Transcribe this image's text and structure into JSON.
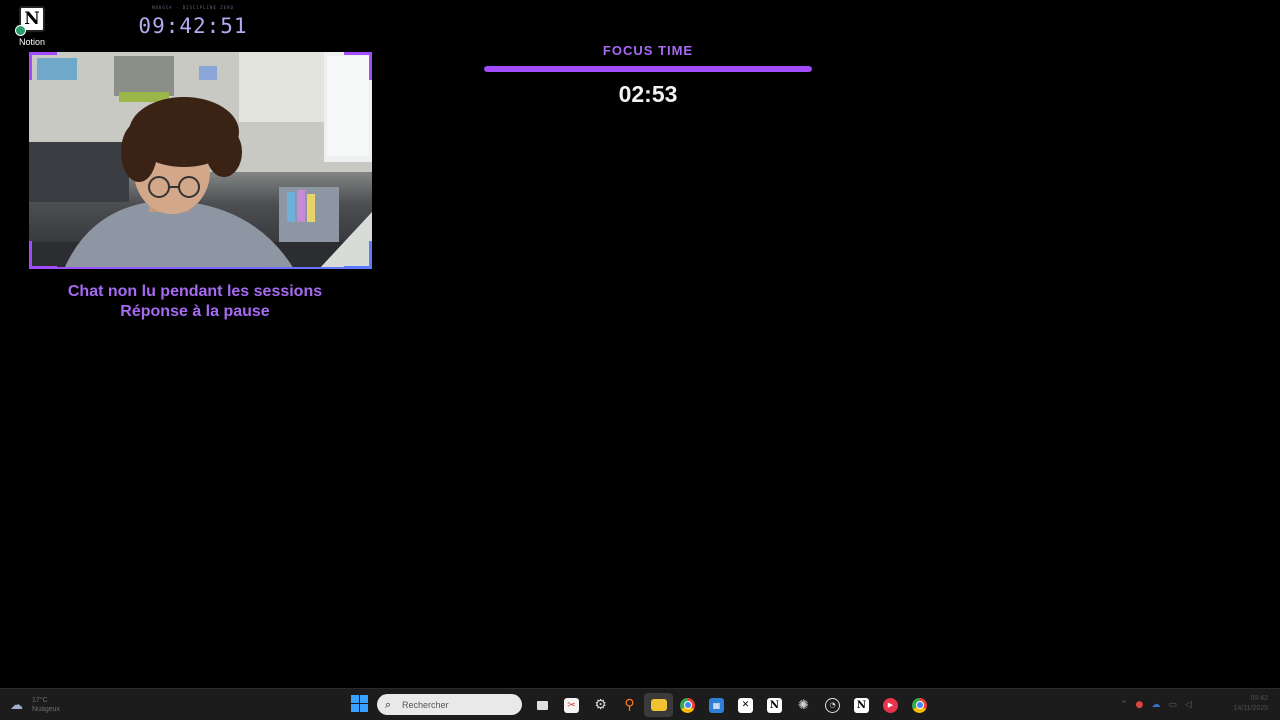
{
  "desktop": {
    "icons": [
      {
        "label": "Notion",
        "icon": "notion-icon"
      }
    ]
  },
  "clock_widget": {
    "caption": "NOUGIA · DISCIPLINE ZERO",
    "time": "09:42:51"
  },
  "webcam": {
    "accent_color": "#a24cff"
  },
  "chat_notice": {
    "line1": "Chat non lu pendant les sessions",
    "line2": "Réponse à la pause"
  },
  "focus": {
    "label": "FOCUS TIME",
    "time_remaining": "02:53",
    "progress_fraction": 1.0,
    "accent_color": "#a24cff"
  },
  "taskbar": {
    "weather": {
      "temp": "17°C",
      "condition": "Nuageux",
      "icon": "weather-cloud-icon"
    },
    "search_placeholder": "Rechercher",
    "apps": [
      {
        "name": "task-view",
        "icon": "task-view-icon"
      },
      {
        "name": "snipping-tool",
        "icon": "snipping-tool-icon"
      },
      {
        "name": "settings",
        "icon": "settings-icon"
      },
      {
        "name": "search-app",
        "icon": "magnifier-app-icon"
      },
      {
        "name": "file-explorer",
        "icon": "folder-icon"
      },
      {
        "name": "chrome",
        "icon": "chrome-icon"
      },
      {
        "name": "microsoft-store",
        "icon": "store-icon"
      },
      {
        "name": "capcut",
        "icon": "capcut-icon"
      },
      {
        "name": "notion",
        "icon": "notion-icon"
      },
      {
        "name": "chatgpt",
        "icon": "openai-icon"
      },
      {
        "name": "obs",
        "icon": "obs-icon"
      },
      {
        "name": "notion-2",
        "icon": "notion-icon"
      },
      {
        "name": "media-player",
        "icon": "play-icon"
      },
      {
        "name": "chrome-profile",
        "icon": "chrome-icon"
      }
    ],
    "tray_clock": {
      "time": "09:42",
      "date": "14/11/2025"
    }
  }
}
